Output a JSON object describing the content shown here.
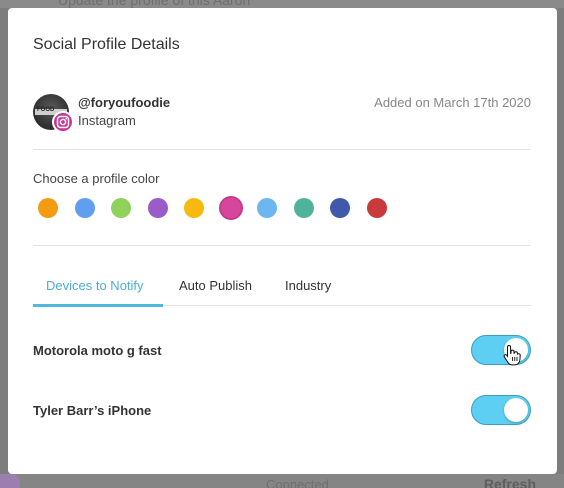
{
  "background": {
    "top_text": "Update the profile of this Aaron",
    "bottom_status": "Connected",
    "bottom_action": "Refresh"
  },
  "modal": {
    "title": "Social Profile Details"
  },
  "profile": {
    "handle": "@foryoufoodie",
    "platform": "Instagram",
    "added": "Added on March 17th 2020",
    "avatar_text": "FOOD"
  },
  "color_picker": {
    "label": "Choose a profile color",
    "colors": [
      "#f39c12",
      "#5f9fed",
      "#8fd15b",
      "#9b5bc9",
      "#f6b90e",
      "#d6469e",
      "#6cb7ef",
      "#4fb39b",
      "#3f5aaa",
      "#cb3a3a"
    ],
    "selected_index": 5
  },
  "tabs": {
    "devices": "Devices to Notify",
    "auto_publish": "Auto Publish",
    "industry": "Industry",
    "active": "devices"
  },
  "devices": [
    {
      "name": "Motorola moto g fast",
      "enabled": true
    },
    {
      "name": "Tyler Barr’s iPhone",
      "enabled": true
    }
  ],
  "accent_color": "#5ccff2"
}
